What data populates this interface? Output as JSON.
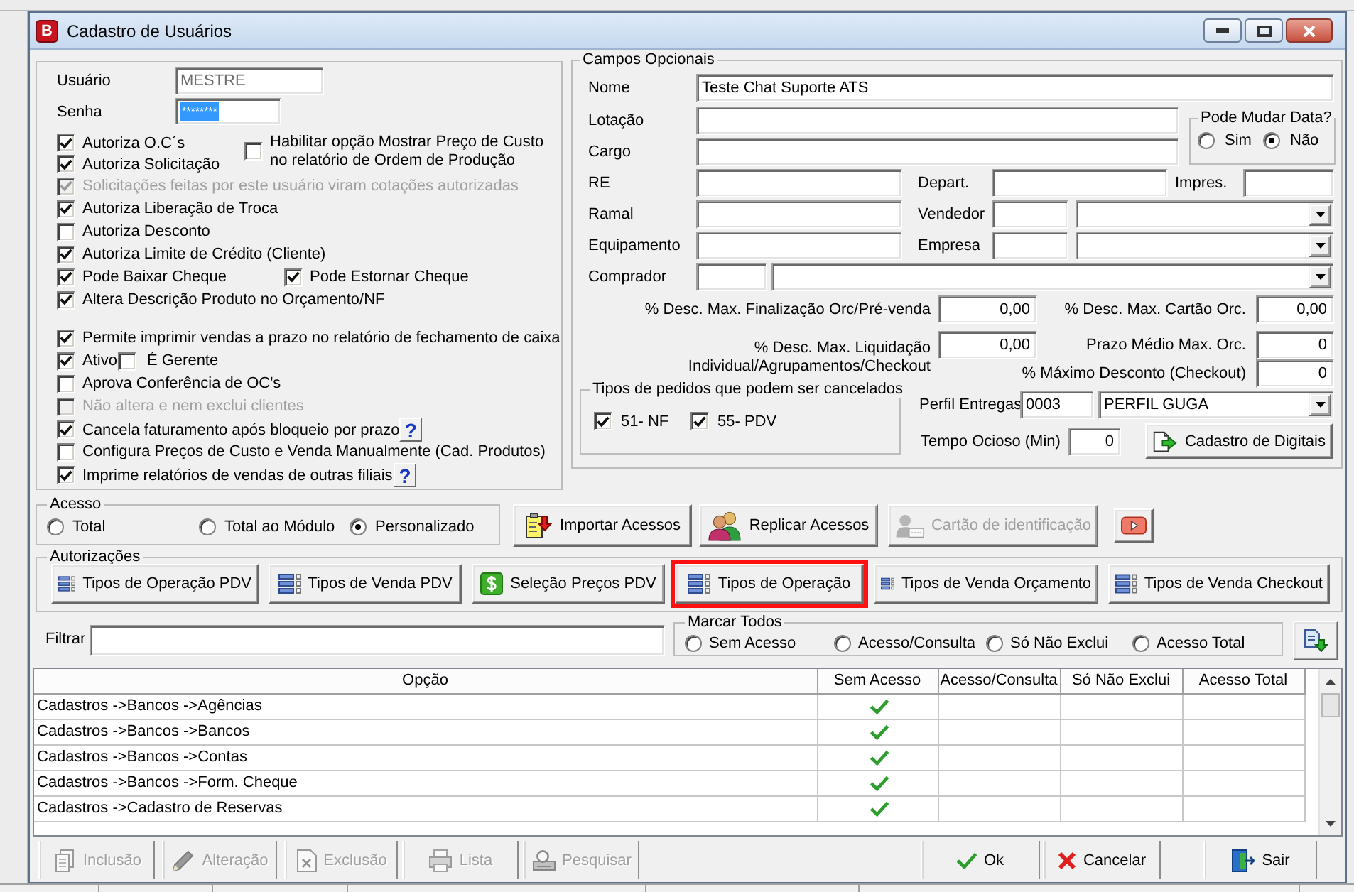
{
  "window": {
    "icon_letter": "B",
    "title": "Cadastro de Usuários"
  },
  "login": {
    "user_label": "Usuário",
    "user_value": "MESTRE",
    "user_disabled": true,
    "password_label": "Senha",
    "password_value": "********",
    "password_selected": true
  },
  "top_checks": [
    {
      "label": "Autoriza O.C´s",
      "checked": true,
      "disabled": false
    },
    {
      "label": "Autoriza Solicitação",
      "checked": true,
      "disabled": false
    }
  ],
  "side_check": {
    "label": "Habilitar opção Mostrar Preço de Custo no relatório de Ordem de Produção",
    "checked": false,
    "disabled": false
  },
  "check_groups": [
    [
      {
        "kind": "single",
        "items": [
          {
            "label": "Solicitações feitas por este usuário viram cotações autorizadas",
            "checked": true,
            "disabled": true
          }
        ]
      },
      {
        "kind": "single",
        "items": [
          {
            "label": "Autoriza Liberação de Troca",
            "checked": true,
            "disabled": false
          }
        ]
      },
      {
        "kind": "single",
        "items": [
          {
            "label": "Autoriza Desconto",
            "checked": false,
            "disabled": false
          }
        ]
      },
      {
        "kind": "single",
        "items": [
          {
            "label": "Autoriza Limite de Crédito (Cliente)",
            "checked": true,
            "disabled": false
          }
        ]
      },
      {
        "kind": "pair",
        "items": [
          {
            "label": "Pode Baixar Cheque",
            "checked": true,
            "disabled": false
          },
          {
            "label": "Pode Estornar Cheque",
            "checked": true,
            "disabled": false
          }
        ]
      },
      {
        "kind": "single",
        "items": [
          {
            "label": "Altera Descrição Produto no Orçamento/NF",
            "checked": true,
            "disabled": false
          }
        ]
      }
    ],
    [
      {
        "kind": "single",
        "items": [
          {
            "label": "Permite imprimir vendas a prazo no relatório de fechamento de caixa",
            "checked": true,
            "disabled": false
          }
        ]
      },
      {
        "kind": "inline",
        "items": [
          {
            "label": "Ativo",
            "checked": true,
            "disabled": false
          },
          {
            "label": "É Gerente",
            "checked": false,
            "disabled": false
          }
        ]
      },
      {
        "kind": "single",
        "items": [
          {
            "label": "Aprova Conferência de OC's",
            "checked": false,
            "disabled": false
          }
        ]
      },
      {
        "kind": "single",
        "items": [
          {
            "label": "Não altera e nem exclui clientes",
            "checked": false,
            "disabled": true
          }
        ]
      },
      {
        "kind": "single",
        "items": [
          {
            "label": "Cancela faturamento após bloqueio por prazo",
            "checked": true,
            "disabled": false
          }
        ],
        "help": "?"
      },
      {
        "kind": "single",
        "items": [
          {
            "label": "Configura Preços de Custo e Venda Manualmente (Cad. Produtos)",
            "checked": false,
            "disabled": false
          }
        ]
      },
      {
        "kind": "single",
        "items": [
          {
            "label": "Imprime relatórios de vendas de outras filiais",
            "checked": true,
            "disabled": false
          }
        ],
        "help": "?"
      }
    ]
  ],
  "optional": {
    "title": "Campos Opcionais",
    "nome": {
      "label": "Nome",
      "value": "Teste Chat Suporte ATS"
    },
    "lotacao": {
      "label": "Lotação"
    },
    "cargo": {
      "label": "Cargo"
    },
    "date_change": {
      "title": "Pode Mudar Data?",
      "options": [
        {
          "label": "Sim",
          "selected": false
        },
        {
          "label": "Não",
          "selected": true
        }
      ]
    },
    "re": {
      "label": "RE"
    },
    "depart": {
      "label": "Depart."
    },
    "impres": {
      "label": "Impres."
    },
    "ramal": {
      "label": "Ramal"
    },
    "vendedor": {
      "label": "Vendedor"
    },
    "equipamento": {
      "label": "Equipamento"
    },
    "empresa": {
      "label": "Empresa"
    },
    "comprador": {
      "label": "Comprador"
    },
    "desc_finalizacao": {
      "label": "% Desc. Max. Finalização Orc/Pré-venda",
      "value": "0,00"
    },
    "desc_cartao": {
      "label": "% Desc. Max. Cartão Orc.",
      "value": "0,00"
    },
    "desc_liquidacao": {
      "label": "% Desc. Max. Liquidação Individual/Agrupamentos/Checkout",
      "value": "0,00"
    },
    "prazo_medio": {
      "label": "Prazo Médio Max. Orc.",
      "value": "0"
    },
    "max_desconto": {
      "label": "% Máximo Desconto (Checkout)",
      "value": "0"
    },
    "cancel_types": {
      "title": "Tipos de pedidos que podem ser cancelados",
      "items": [
        {
          "label": "51- NF",
          "checked": true
        },
        {
          "label": "55- PDV",
          "checked": true
        }
      ]
    },
    "perfil_entregas": {
      "label": "Perfil Entregas",
      "code": "0003",
      "name": "PERFIL GUGA"
    },
    "tempo_ocioso": {
      "label": "Tempo Ocioso (Min)",
      "value": "0"
    },
    "digitais_button": {
      "label": "Cadastro de Digitais"
    }
  },
  "access": {
    "title": "Acesso",
    "options": [
      {
        "label": "Total",
        "selected": false
      },
      {
        "label": "Total ao Módulo",
        "selected": false
      },
      {
        "label": "Personalizado",
        "selected": true
      }
    ]
  },
  "access_buttons": [
    {
      "kind": "import",
      "label": "Importar Acessos",
      "disabled": false
    },
    {
      "kind": "replicate",
      "label": "Replicar Acessos",
      "disabled": false
    },
    {
      "kind": "card",
      "label": "Cartão de identificação",
      "disabled": true
    },
    {
      "kind": "video",
      "disabled": false
    }
  ],
  "authorizations": {
    "title": "Autorizações",
    "buttons": [
      {
        "kind": "list",
        "label": "Tipos de Operação PDV",
        "highlighted": false
      },
      {
        "kind": "list",
        "label": "Tipos de Venda PDV",
        "highlighted": false
      },
      {
        "kind": "price",
        "label": "Seleção Preços PDV",
        "highlighted": false
      },
      {
        "kind": "list",
        "label": "Tipos de Operação",
        "highlighted": true
      },
      {
        "kind": "list",
        "label": "Tipos de Venda Orçamento",
        "highlighted": false
      },
      {
        "kind": "list",
        "label": "Tipos de Venda Checkout",
        "highlighted": false
      }
    ]
  },
  "filter": {
    "label": "Filtrar"
  },
  "mark_all": {
    "title": "Marcar Todos",
    "options": [
      {
        "label": "Sem Acesso",
        "selected": false
      },
      {
        "label": "Acesso/Consulta",
        "selected": false
      },
      {
        "label": "Só Não Exclui",
        "selected": false
      },
      {
        "label": "Acesso Total",
        "selected": false
      }
    ]
  },
  "table": {
    "columns": [
      "Opção",
      "Sem Acesso",
      "Acesso/Consulta",
      "Só Não Exclui",
      "Acesso Total"
    ],
    "rows": [
      {
        "option": "Cadastros ->Bancos ->Agências",
        "access": [
          true,
          false,
          false,
          false
        ]
      },
      {
        "option": "Cadastros ->Bancos ->Bancos",
        "access": [
          true,
          false,
          false,
          false
        ]
      },
      {
        "option": "Cadastros ->Bancos ->Contas",
        "access": [
          true,
          false,
          false,
          false
        ]
      },
      {
        "option": "Cadastros ->Bancos ->Form. Cheque",
        "access": [
          true,
          false,
          false,
          false
        ]
      },
      {
        "option": "Cadastros ->Cadastro de Reservas",
        "access": [
          true,
          false,
          false,
          false
        ]
      }
    ]
  },
  "toolbar": {
    "left": [
      {
        "kind": "add",
        "label": "Inclusão",
        "disabled": true
      },
      {
        "kind": "edit",
        "label": "Alteração",
        "disabled": true
      },
      {
        "kind": "delete",
        "label": "Exclusão",
        "disabled": true
      },
      {
        "kind": "print",
        "label": "Lista",
        "disabled": true
      },
      {
        "kind": "search",
        "label": "Pesquisar",
        "disabled": true
      }
    ],
    "right": [
      {
        "kind": "ok",
        "label": "Ok",
        "disabled": false
      },
      {
        "kind": "cancel",
        "label": "Cancelar",
        "disabled": false
      },
      {
        "kind": "exit",
        "label": "Sair",
        "disabled": false
      }
    ]
  }
}
